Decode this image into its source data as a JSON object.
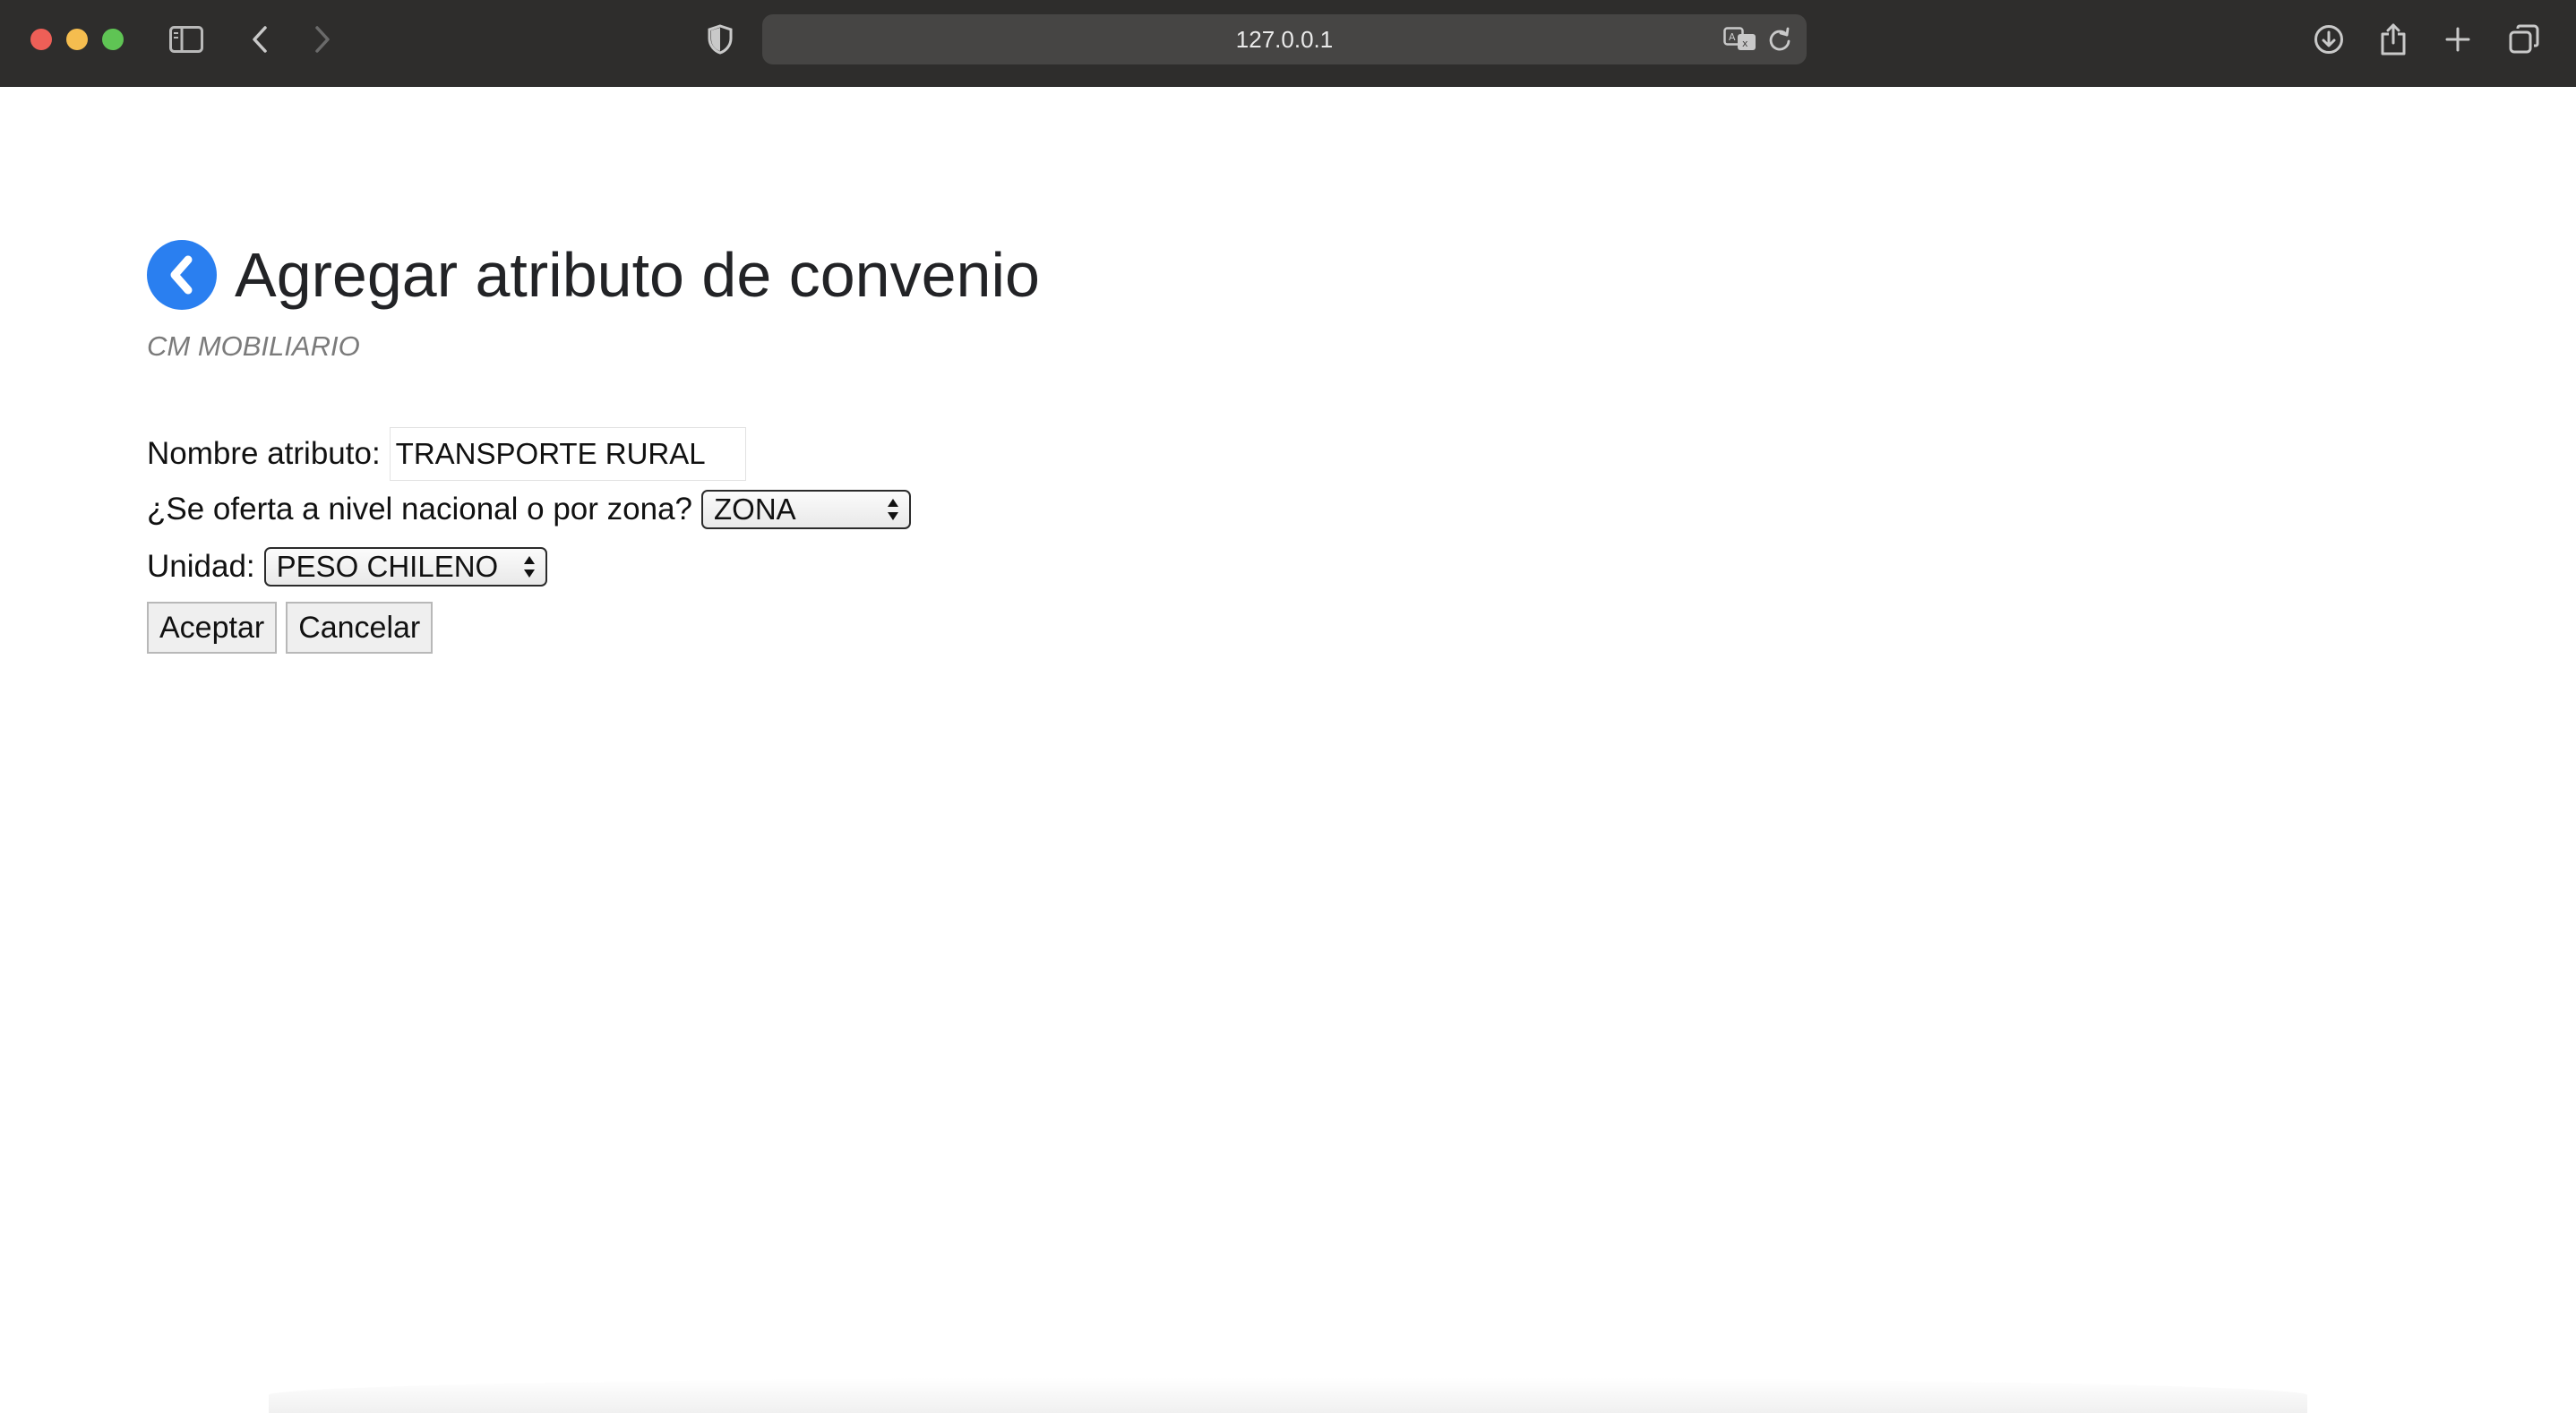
{
  "browser": {
    "address": "127.0.0.1",
    "icons": [
      "sidebar-icon",
      "back-arrow-icon",
      "forward-arrow-icon",
      "shield-icon",
      "translate-icon",
      "reload-icon",
      "download-icon",
      "share-icon",
      "new-tab-icon",
      "tabs-overview-icon"
    ]
  },
  "page": {
    "title": "Agregar atributo de convenio",
    "subtitle": "CM MOBILIARIO",
    "accent_color": "#2a7ff0"
  },
  "form": {
    "nombre_label": "Nombre atributo:",
    "nombre_value": "TRANSPORTE RURAL",
    "zona_label": "¿Se oferta a nivel nacional o por zona?",
    "zona_selected": "ZONA",
    "unidad_label": "Unidad:",
    "unidad_selected": "PESO CHILENO",
    "accept_label": "Aceptar",
    "cancel_label": "Cancelar"
  }
}
